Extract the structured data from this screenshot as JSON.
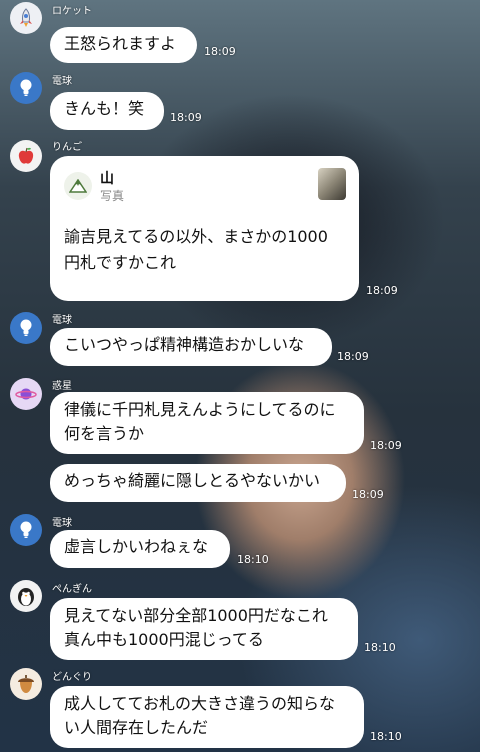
{
  "messages": [
    {
      "sender": "ロケット",
      "avatar_icon": "rocket-icon",
      "lines": [
        "王怒られますよ"
      ],
      "time": "18:09"
    },
    {
      "sender": "電球",
      "avatar_icon": "lightbulb-icon",
      "lines": [
        "きんも！笑"
      ],
      "time": "18:09"
    },
    {
      "sender": "りんご",
      "avatar_icon": "apple-icon",
      "card": {
        "title": "山",
        "subtitle": "写真",
        "icon": "mountain-icon",
        "thumb": "photo-thumbnail"
      },
      "lines": [
        "諭吉見えてるの以外、まさかの1000",
        "円札ですかこれ"
      ],
      "time": "18:09"
    },
    {
      "sender": "電球",
      "avatar_icon": "lightbulb-icon",
      "lines": [
        "こいつやっぱ精神構造おかしいな"
      ],
      "time": "18:09"
    },
    {
      "sender": "惑星",
      "avatar_icon": "planet-icon",
      "lines": [
        "律儀に千円札見えんようにしてるのに",
        "何を言うか"
      ],
      "time": "18:09"
    },
    {
      "sender": "",
      "avatar_icon": "",
      "lines": [
        "めっちゃ綺麗に隠しとるやないかい"
      ],
      "time": "18:09"
    },
    {
      "sender": "電球",
      "avatar_icon": "lightbulb-icon",
      "lines": [
        "虚言しかいわねぇな"
      ],
      "time": "18:10"
    },
    {
      "sender": "ぺんぎん",
      "avatar_icon": "penguin-icon",
      "lines": [
        "見えてない部分全部1000円だなこれ",
        "真ん中も1000円混じってる"
      ],
      "time": "18:10"
    },
    {
      "sender": "どんぐり",
      "avatar_icon": "acorn-icon",
      "lines": [
        "成人しててお札の大きさ違うの知らな",
        "い人間存在したんだ"
      ],
      "time": "18:10"
    }
  ]
}
